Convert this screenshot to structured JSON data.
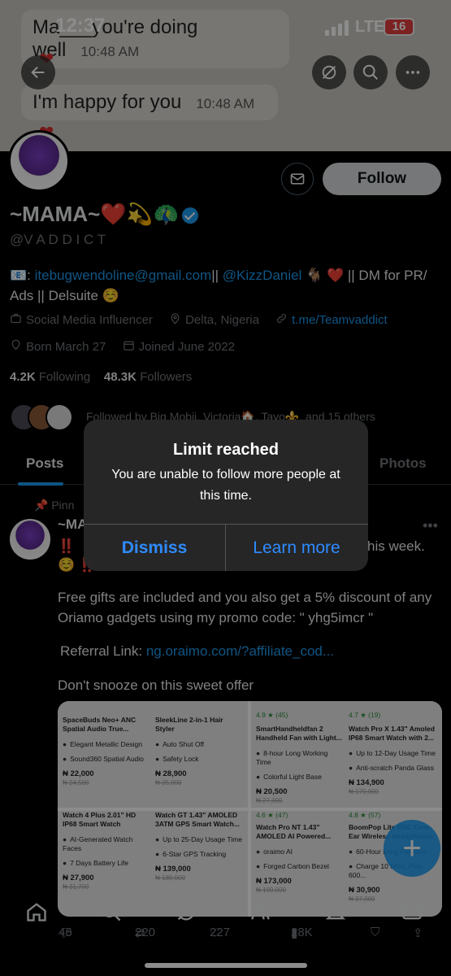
{
  "status_bar": {
    "time": "12:37",
    "network": "LTE",
    "battery": "16"
  },
  "banner": {
    "messages": [
      {
        "text": "Ma___you're doing well",
        "time": "10:48 AM"
      },
      {
        "text": "I'm happy for you",
        "time": "10:48 AM"
      }
    ]
  },
  "profile": {
    "follow_label": "Follow",
    "name": "~MAMA~❤️💫🦚",
    "handle": "@V A D D I C T",
    "bio": {
      "prefix": "📧: ",
      "email": "itebugwendoline@gmail.com",
      "sep": "|| ",
      "mention": "@KizzDaniel",
      "suffix": " 🐐 ❤️ || DM for PR/ Ads || Delsuite ☺️"
    },
    "category": "Social Media Influencer",
    "location": "Delta, Nigeria",
    "website": "t.me/Teamvaddict",
    "born": "Born March 27",
    "joined": "Joined June 2022",
    "following_count": "4.2K",
    "following_label": "Following",
    "followers_count": "48.3K",
    "followers_label": "Followers",
    "followed_by": "Followed by Big Mobii, Victoria🏠, Tayo⚜️, and 15 others"
  },
  "tabs": {
    "posts": "Posts",
    "photos": "Photos"
  },
  "post": {
    "pinned_label": "Pinn",
    "author": "~MA",
    "line1_end": "his week.",
    "line2": "☺️ ‼️",
    "gifts": "Free gifts are included and you also get a 5% discount of any Oriamo gadgets using my promo code: \" yhg5imcr \"",
    "referral_label": "Referral Link: ",
    "referral_link": "ng.oraimo.com/?affiliate_cod...",
    "closing": "Don't snooze on this sweet offer",
    "stats": {
      "replies": "46",
      "reposts": "220",
      "likes": "227",
      "views": "28K"
    }
  },
  "products": [
    {
      "name": "SpaceBuds Neo+ ANC Spatial Audio True...",
      "f1": "Elegant Metallic Design",
      "f2": "Sound360 Spatial Audio",
      "price": "₦ 22,000",
      "old": "₦ 24,500"
    },
    {
      "name": "SleekLine 2-in-1 Hair Styler",
      "f1": "Auto Shut Off",
      "f2": "Safety Lock",
      "price": "₦ 28,900",
      "old": "₦ 35,000"
    },
    {
      "name": "SmartHandheldfan 2 Handheld Fan with Light...",
      "rating": "4.9 ★ (45)",
      "f1": "8-hour Long Working Time",
      "f2": "Colorful Light Base",
      "price": "₦ 20,500",
      "old": "₦ 27,300"
    },
    {
      "name": "Watch Pro X 1.43\" Amoled IP68 Smart Watch with 2...",
      "rating": "4.7 ★ (19)",
      "f1": "Up to 12-Day Usage Time",
      "f2": "Anti-scratch Panda Glass",
      "price": "₦ 134,900",
      "old": "₦ 170,000"
    },
    {
      "name": "Watch 4 Plus 2.01\" HD IP68 Smart Watch",
      "f1": "AI-Generated Watch Faces",
      "f2": "7 Days Battery Life",
      "price": "₦ 27,900",
      "old": "₦ 31,700"
    },
    {
      "name": "Watch GT 1.43\" AMOLED 3ATM GPS Smart Watch...",
      "f1": "Up to 25-Day Usage Time",
      "f2": "6-Star GPS Tracking",
      "price": "₦ 139,000",
      "old": "₦ 180,000"
    },
    {
      "name": "Watch Pro NT 1.43\" AMOLED AI Powered...",
      "rating": "4.6 ★ (47)",
      "f1": "oraimo AI",
      "f2": "Forged Carbon Bezel",
      "price": "₦ 173,000",
      "old": "₦ 199,000"
    },
    {
      "name": "BoomPop Lite ENC Over-Ear Wireless Headphones",
      "rating": "4.8 ★ (57)",
      "f1": "60-Hour Long Playtime",
      "f2": "Charge 10 Mins, Play 600...",
      "price": "₦ 30,900",
      "old": "₦ 37,000"
    }
  ],
  "dialog": {
    "title": "Limit reached",
    "message": "You are unable to follow more people at this time.",
    "dismiss": "Dismiss",
    "learn_more": "Learn more"
  },
  "colors": {
    "accent": "#1d9bf0",
    "dialog_button": "#2e8bff"
  }
}
